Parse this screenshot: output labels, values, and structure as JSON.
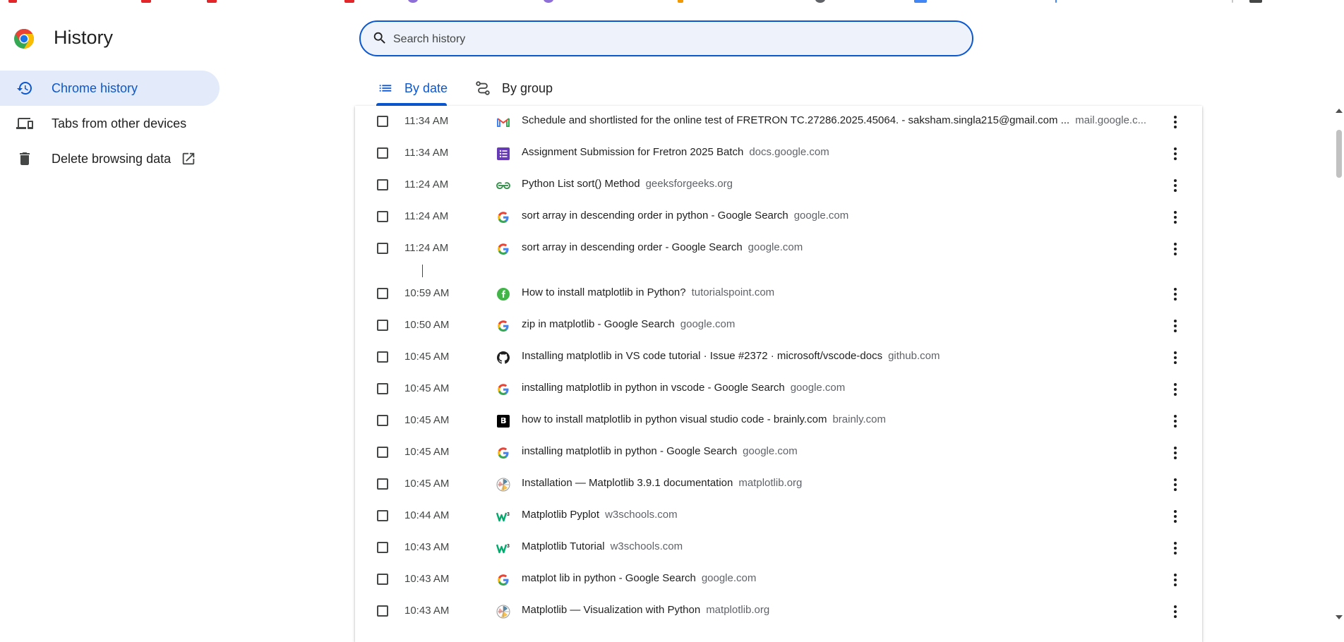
{
  "page": {
    "title": "History"
  },
  "sidebar": {
    "items": [
      {
        "label": "Chrome history",
        "icon": "history-icon",
        "active": true
      },
      {
        "label": "Tabs from other devices",
        "icon": "devices-icon",
        "active": false
      },
      {
        "label": "Delete browsing data",
        "icon": "trash-icon",
        "active": false,
        "external": "open-in-new-icon"
      }
    ]
  },
  "search": {
    "placeholder": "Search history",
    "value": ""
  },
  "tabs": [
    {
      "label": "By date",
      "icon": "list-icon",
      "active": true
    },
    {
      "label": "By group",
      "icon": "group-icon",
      "active": false
    }
  ],
  "history": {
    "entries": [
      {
        "time": "11:34 AM",
        "title": "Schedule and shortlisted for the online test of FRETRON TC.27286.2025.45064. - saksham.singla215@gmail.com ...",
        "domain": "mail.google.c...",
        "favicon": "gmail-icon"
      },
      {
        "time": "11:34 AM",
        "title": "Assignment Submission for Fretron 2025 Batch",
        "domain": "docs.google.com",
        "favicon": "google-forms-icon"
      },
      {
        "time": "11:24 AM",
        "title": "Python List sort() Method",
        "domain": "geeksforgeeks.org",
        "favicon": "geeksforgeeks-icon"
      },
      {
        "time": "11:24 AM",
        "title": "sort array in descending order in python - Google Search",
        "domain": "google.com",
        "favicon": "google-icon"
      },
      {
        "time": "11:24 AM",
        "title": "sort array in descending order - Google Search",
        "domain": "google.com",
        "favicon": "google-icon"
      },
      {
        "time": "10:59 AM",
        "title": "How to install matplotlib in Python?",
        "domain": "tutorialspoint.com",
        "favicon": "tutorialspoint-icon"
      },
      {
        "time": "10:50 AM",
        "title": "zip in matplotlib - Google Search",
        "domain": "google.com",
        "favicon": "google-icon"
      },
      {
        "time": "10:45 AM",
        "title": "Installing matplotlib in VS code tutorial · Issue #2372 · microsoft/vscode-docs",
        "domain": "github.com",
        "favicon": "github-icon"
      },
      {
        "time": "10:45 AM",
        "title": "installing matplotlib in python in vscode - Google Search",
        "domain": "google.com",
        "favicon": "google-icon"
      },
      {
        "time": "10:45 AM",
        "title": "how to install matplotlib in python visual studio code - brainly.com",
        "domain": "brainly.com",
        "favicon": "brainly-icon"
      },
      {
        "time": "10:45 AM",
        "title": "installing matplotlib in python - Google Search",
        "domain": "google.com",
        "favicon": "google-icon"
      },
      {
        "time": "10:45 AM",
        "title": "Installation — Matplotlib 3.9.1 documentation",
        "domain": "matplotlib.org",
        "favicon": "matplotlib-icon"
      },
      {
        "time": "10:44 AM",
        "title": "Matplotlib Pyplot",
        "domain": "w3schools.com",
        "favicon": "w3schools-icon"
      },
      {
        "time": "10:43 AM",
        "title": "Matplotlib Tutorial",
        "domain": "w3schools.com",
        "favicon": "w3schools-icon"
      },
      {
        "time": "10:43 AM",
        "title": "matplot lib in python - Google Search",
        "domain": "google.com",
        "favicon": "google-icon"
      },
      {
        "time": "10:43 AM",
        "title": "Matplotlib — Visualization with Python",
        "domain": "matplotlib.org",
        "favicon": "matplotlib-icon"
      }
    ]
  },
  "colors": {
    "accent": "#0b57d0",
    "active_bg": "#e3ebfa",
    "search_bg": "#eef2fb"
  }
}
